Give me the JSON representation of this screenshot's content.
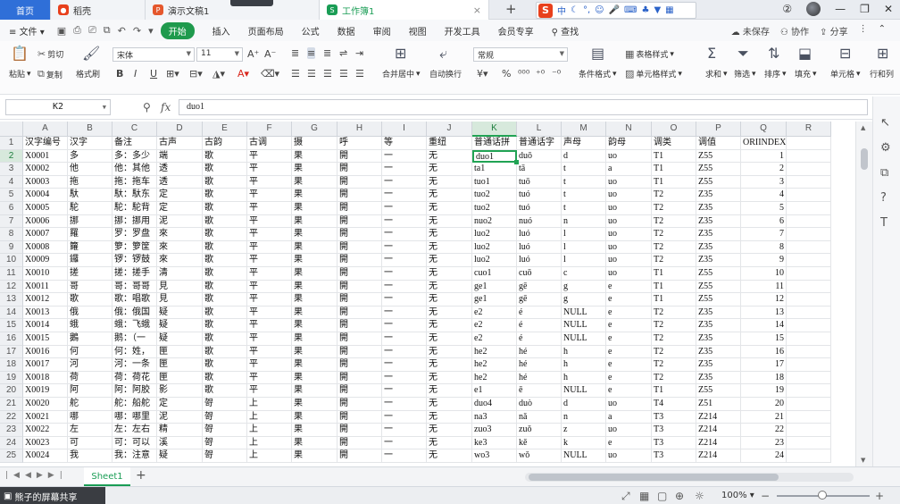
{
  "tabs": {
    "home": "首页",
    "daoke": "稻壳",
    "doc": "演示文稿1",
    "workbook": "工作簿1",
    "new_tab": "+"
  },
  "ime": {
    "logo": "S",
    "mode": "中"
  },
  "menu": {
    "file": "文件",
    "start": "开始",
    "items": [
      "插入",
      "页面布局",
      "公式",
      "数据",
      "审阅",
      "视图",
      "开发工具",
      "会员专享"
    ],
    "search": "查找",
    "unsaved": "未保存",
    "collab": "协作",
    "share": "分享"
  },
  "ribbon": {
    "paste": "粘贴",
    "cut": "剪切",
    "copy": "复制",
    "format_painter": "格式刷",
    "font_name": "宋体",
    "font_size": "11",
    "merge_center": "合并居中",
    "wrap_text": "自动换行",
    "number_format": "常规",
    "table_style": "表格样式",
    "cond_format": "条件格式",
    "cell_style": "单元格样式",
    "sum": "求和",
    "filter": "筛选",
    "sort": "排序",
    "fill": "填充",
    "cells": "单元格",
    "rows_cols": "行和列"
  },
  "formula_bar": {
    "cell_ref": "K2",
    "value": "duo1"
  },
  "columns": [
    "A",
    "B",
    "C",
    "D",
    "E",
    "F",
    "G",
    "H",
    "I",
    "J",
    "K",
    "L",
    "M",
    "N",
    "O",
    "P",
    "Q",
    "R"
  ],
  "row_numbers": [
    "1",
    "2",
    "3",
    "4",
    "5",
    "6",
    "7",
    "8",
    "9",
    "10",
    "11",
    "12",
    "13",
    "14",
    "15",
    "16",
    "17",
    "18",
    "19",
    "20",
    "21",
    "22",
    "23",
    "24",
    "25"
  ],
  "rows": [
    [
      "汉字编号",
      "汉字",
      "备注",
      "古声",
      "古韵",
      "古调",
      "摄",
      "呼",
      "等",
      "重纽",
      "普通话拼",
      "普通话字",
      "声母",
      "韵母",
      "调类",
      "调值",
      "ORIINDEX",
      ""
    ],
    [
      "X0001",
      "多",
      "多：多少",
      "端",
      "歌",
      "平",
      "果",
      "開",
      "一",
      "无",
      "duo1",
      "duō",
      "d",
      "uo",
      "T1",
      "Z55",
      "1",
      ""
    ],
    [
      "X0002",
      "他",
      "他：其他",
      "透",
      "歌",
      "平",
      "果",
      "開",
      "一",
      "无",
      "ta1",
      "tā",
      "t",
      "a",
      "T1",
      "Z55",
      "2",
      ""
    ],
    [
      "X0003",
      "拖",
      "拖：拖车",
      "透",
      "歌",
      "平",
      "果",
      "開",
      "一",
      "无",
      "tuo1",
      "tuō",
      "t",
      "uo",
      "T1",
      "Z55",
      "3",
      ""
    ],
    [
      "X0004",
      "馱",
      "馱：馱东",
      "定",
      "歌",
      "平",
      "果",
      "開",
      "一",
      "无",
      "tuo2",
      "tuó",
      "t",
      "uo",
      "T2",
      "Z35",
      "4",
      ""
    ],
    [
      "X0005",
      "駝",
      "駝：駝背",
      "定",
      "歌",
      "平",
      "果",
      "開",
      "一",
      "无",
      "tuo2",
      "tuó",
      "t",
      "uo",
      "T2",
      "Z35",
      "5",
      ""
    ],
    [
      "X0006",
      "挪",
      "挪：挪用",
      "泥",
      "歌",
      "平",
      "果",
      "開",
      "一",
      "无",
      "nuo2",
      "nuó",
      "n",
      "uo",
      "T2",
      "Z35",
      "6",
      ""
    ],
    [
      "X0007",
      "羅",
      "罗：罗盘",
      "來",
      "歌",
      "平",
      "果",
      "開",
      "一",
      "无",
      "luo2",
      "luó",
      "l",
      "uo",
      "T2",
      "Z35",
      "7",
      ""
    ],
    [
      "X0008",
      "籮",
      "箩：箩筐",
      "來",
      "歌",
      "平",
      "果",
      "開",
      "一",
      "无",
      "luo2",
      "luó",
      "l",
      "uo",
      "T2",
      "Z35",
      "8",
      ""
    ],
    [
      "X0009",
      "鑼",
      "锣：锣鼓",
      "來",
      "歌",
      "平",
      "果",
      "開",
      "一",
      "无",
      "luo2",
      "luó",
      "l",
      "uo",
      "T2",
      "Z35",
      "9",
      ""
    ],
    [
      "X0010",
      "搓",
      "搓：搓手",
      "清",
      "歌",
      "平",
      "果",
      "開",
      "一",
      "无",
      "cuo1",
      "cuō",
      "c",
      "uo",
      "T1",
      "Z55",
      "10",
      ""
    ],
    [
      "X0011",
      "哥",
      "哥：哥哥",
      "見",
      "歌",
      "平",
      "果",
      "開",
      "一",
      "无",
      "ge1",
      "gē",
      "g",
      "e",
      "T1",
      "Z55",
      "11",
      ""
    ],
    [
      "X0012",
      "歌",
      "歌：唱歌",
      "見",
      "歌",
      "平",
      "果",
      "開",
      "一",
      "无",
      "ge1",
      "gē",
      "g",
      "e",
      "T1",
      "Z55",
      "12",
      ""
    ],
    [
      "X0013",
      "俄",
      "俄：俄国",
      "疑",
      "歌",
      "平",
      "果",
      "開",
      "一",
      "无",
      "e2",
      "é",
      "NULL",
      "e",
      "T2",
      "Z35",
      "13",
      ""
    ],
    [
      "X0014",
      "蛾",
      "蛾：飞蛾",
      "疑",
      "歌",
      "平",
      "果",
      "開",
      "一",
      "无",
      "e2",
      "é",
      "NULL",
      "e",
      "T2",
      "Z35",
      "14",
      ""
    ],
    [
      "X0015",
      "鵝",
      "鹅：（一",
      "疑",
      "歌",
      "平",
      "果",
      "開",
      "一",
      "无",
      "e2",
      "é",
      "NULL",
      "e",
      "T2",
      "Z35",
      "15",
      ""
    ],
    [
      "X0016",
      "何",
      "何：姓，",
      "匣",
      "歌",
      "平",
      "果",
      "開",
      "一",
      "无",
      "he2",
      "hé",
      "h",
      "e",
      "T2",
      "Z35",
      "16",
      ""
    ],
    [
      "X0017",
      "河",
      "河：一条",
      "匣",
      "歌",
      "平",
      "果",
      "開",
      "一",
      "无",
      "he2",
      "hé",
      "h",
      "e",
      "T2",
      "Z35",
      "17",
      ""
    ],
    [
      "X0018",
      "荷",
      "荷：荷花",
      "匣",
      "歌",
      "平",
      "果",
      "開",
      "一",
      "无",
      "he2",
      "hé",
      "h",
      "e",
      "T2",
      "Z35",
      "18",
      ""
    ],
    [
      "X0019",
      "阿",
      "阿：阿胶",
      "影",
      "歌",
      "平",
      "果",
      "開",
      "一",
      "无",
      "e1",
      "ē",
      "NULL",
      "e",
      "T1",
      "Z55",
      "19",
      ""
    ],
    [
      "X0020",
      "舵",
      "舵：船舵",
      "定",
      "哿",
      "上",
      "果",
      "開",
      "一",
      "无",
      "duo4",
      "duò",
      "d",
      "uo",
      "T4",
      "Z51",
      "20",
      ""
    ],
    [
      "X0021",
      "哪",
      "哪：哪里",
      "泥",
      "哿",
      "上",
      "果",
      "開",
      "一",
      "无",
      "na3",
      "nǎ",
      "n",
      "a",
      "T3",
      "Z214",
      "21",
      ""
    ],
    [
      "X0022",
      "左",
      "左：左右",
      "精",
      "哿",
      "上",
      "果",
      "開",
      "一",
      "无",
      "zuo3",
      "zuǒ",
      "z",
      "uo",
      "T3",
      "Z214",
      "22",
      ""
    ],
    [
      "X0023",
      "可",
      "可：可以",
      "溪",
      "哿",
      "上",
      "果",
      "開",
      "一",
      "无",
      "ke3",
      "kě",
      "k",
      "e",
      "T3",
      "Z214",
      "23",
      ""
    ],
    [
      "X0024",
      "我",
      "我：注意",
      "疑",
      "哿",
      "上",
      "果",
      "開",
      "一",
      "无",
      "wo3",
      "wǒ",
      "NULL",
      "uo",
      "T3",
      "Z214",
      "24",
      ""
    ]
  ],
  "numeric_column_index": 16,
  "active_cell": {
    "row": 1,
    "col": 10
  },
  "sheet": {
    "name": "Sheet1",
    "add": "+"
  },
  "status": {
    "share_text": "熊子的屏幕共享",
    "zoom": "100%"
  },
  "colors": {
    "accent_green": "#21a354",
    "home_blue": "#2f6fd8",
    "ime_red": "#e8401c"
  }
}
